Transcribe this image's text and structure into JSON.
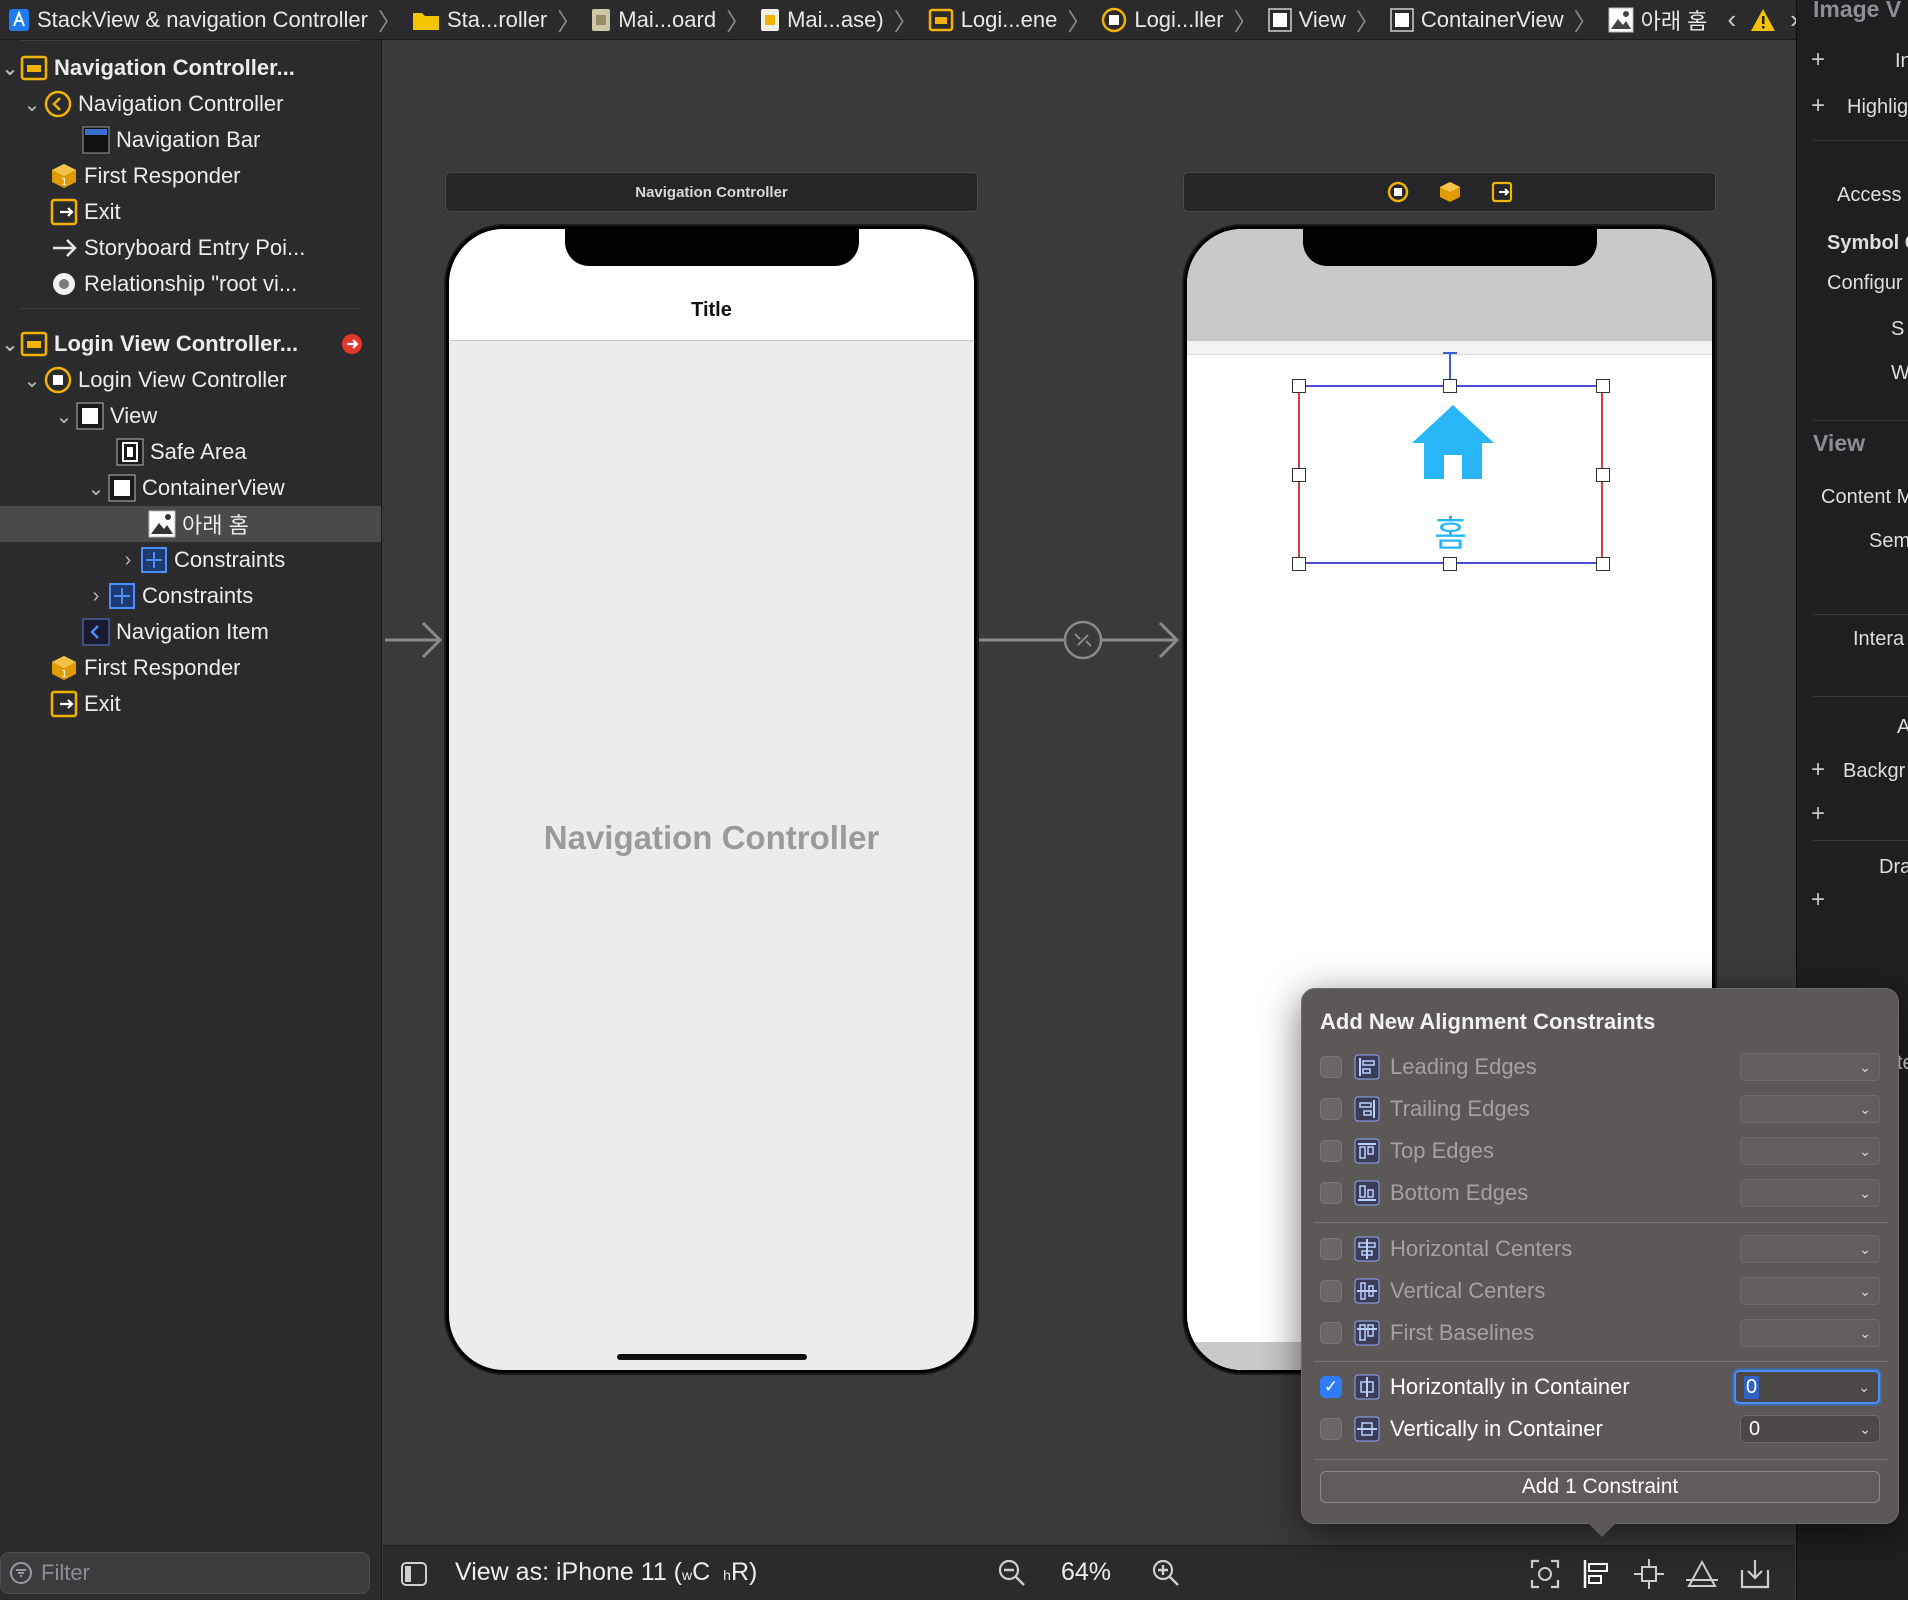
{
  "breadcrumb": {
    "items": [
      {
        "label": "StackView & navigation Controller",
        "icon": "project-icon"
      },
      {
        "label": "Sta...roller",
        "icon": "folder-icon"
      },
      {
        "label": "Mai...oard",
        "icon": "storyboard-file-icon"
      },
      {
        "label": "Mai...ase)",
        "icon": "storyboard-base-icon"
      },
      {
        "label": "Logi...ene",
        "icon": "scene-icon"
      },
      {
        "label": "Logi...ller",
        "icon": "view-controller-icon"
      },
      {
        "label": "View",
        "icon": "view-icon"
      },
      {
        "label": "ContainerView",
        "icon": "view-icon"
      },
      {
        "label": "아래 홈",
        "icon": "image-view-icon"
      }
    ]
  },
  "navigator": {
    "items": [
      {
        "label": "Navigation Controller...",
        "icon": "scene-icon",
        "bold": true
      },
      {
        "label": "Navigation Controller",
        "icon": "nav-controller-icon"
      },
      {
        "label": "Navigation Bar",
        "icon": "nav-bar-icon"
      },
      {
        "label": "First Responder",
        "icon": "first-responder-icon"
      },
      {
        "label": "Exit",
        "icon": "exit-icon"
      },
      {
        "label": "Storyboard Entry Poi...",
        "icon": "arrow-right-icon"
      },
      {
        "label": "Relationship \"root vi...",
        "icon": "relationship-icon"
      },
      {
        "label": "Login View Controller...",
        "icon": "scene-icon",
        "bold": true
      },
      {
        "label": "Login View Controller",
        "icon": "view-controller-icon"
      },
      {
        "label": "View",
        "icon": "view-icon"
      },
      {
        "label": "Safe Area",
        "icon": "safe-area-icon"
      },
      {
        "label": "ContainerView",
        "icon": "view-icon"
      },
      {
        "label": "아래 홈",
        "icon": "image-view-icon",
        "selected": true
      },
      {
        "label": "Constraints",
        "icon": "constraints-icon"
      },
      {
        "label": "Constraints",
        "icon": "constraints-icon"
      },
      {
        "label": "Navigation Item",
        "icon": "nav-item-icon"
      },
      {
        "label": "First Responder",
        "icon": "first-responder-icon"
      },
      {
        "label": "Exit",
        "icon": "exit-icon"
      }
    ],
    "filter_placeholder": "Filter"
  },
  "canvas": {
    "nav_scene_title": "Navigation Controller",
    "nav_bar_title": "Title",
    "nav_placeholder": "Navigation Controller",
    "image_label": "홈"
  },
  "toolbar": {
    "view_as_prefix": "View as: iPhone 11 (",
    "w_small": "w",
    "w_big": "C",
    "h_small": "h",
    "h_big": "R",
    "view_as_suffix": ")",
    "zoom": "64%"
  },
  "inspector": {
    "header": "Image V",
    "rows": [
      "In",
      "Highlig",
      "Access",
      "Symbol C",
      "Configur",
      "S",
      "W",
      "View",
      "Content M",
      "Sem",
      "Intera",
      "A",
      "Backgr",
      "Dra",
      "te"
    ]
  },
  "align_popover": {
    "title": "Add New Alignment Constraints",
    "edges": [
      {
        "label": "Leading Edges",
        "checked": false,
        "value": ""
      },
      {
        "label": "Trailing Edges",
        "checked": false,
        "value": ""
      },
      {
        "label": "Top Edges",
        "checked": false,
        "value": ""
      },
      {
        "label": "Bottom Edges",
        "checked": false,
        "value": ""
      }
    ],
    "centers": [
      {
        "label": "Horizontal Centers",
        "checked": false,
        "value": ""
      },
      {
        "label": "Vertical Centers",
        "checked": false,
        "value": ""
      },
      {
        "label": "First Baselines",
        "checked": false,
        "value": ""
      }
    ],
    "container": [
      {
        "label": "Horizontally in Container",
        "checked": true,
        "value": "0"
      },
      {
        "label": "Vertically in Container",
        "checked": false,
        "value": "0"
      }
    ],
    "add_button": "Add 1 Constraint"
  },
  "colors": {
    "accent": "#2f7cf6",
    "image_tint": "#29b6f6",
    "warning": "#f5c400",
    "error": "#e5362c",
    "icon_yellow": "#f0b400"
  }
}
